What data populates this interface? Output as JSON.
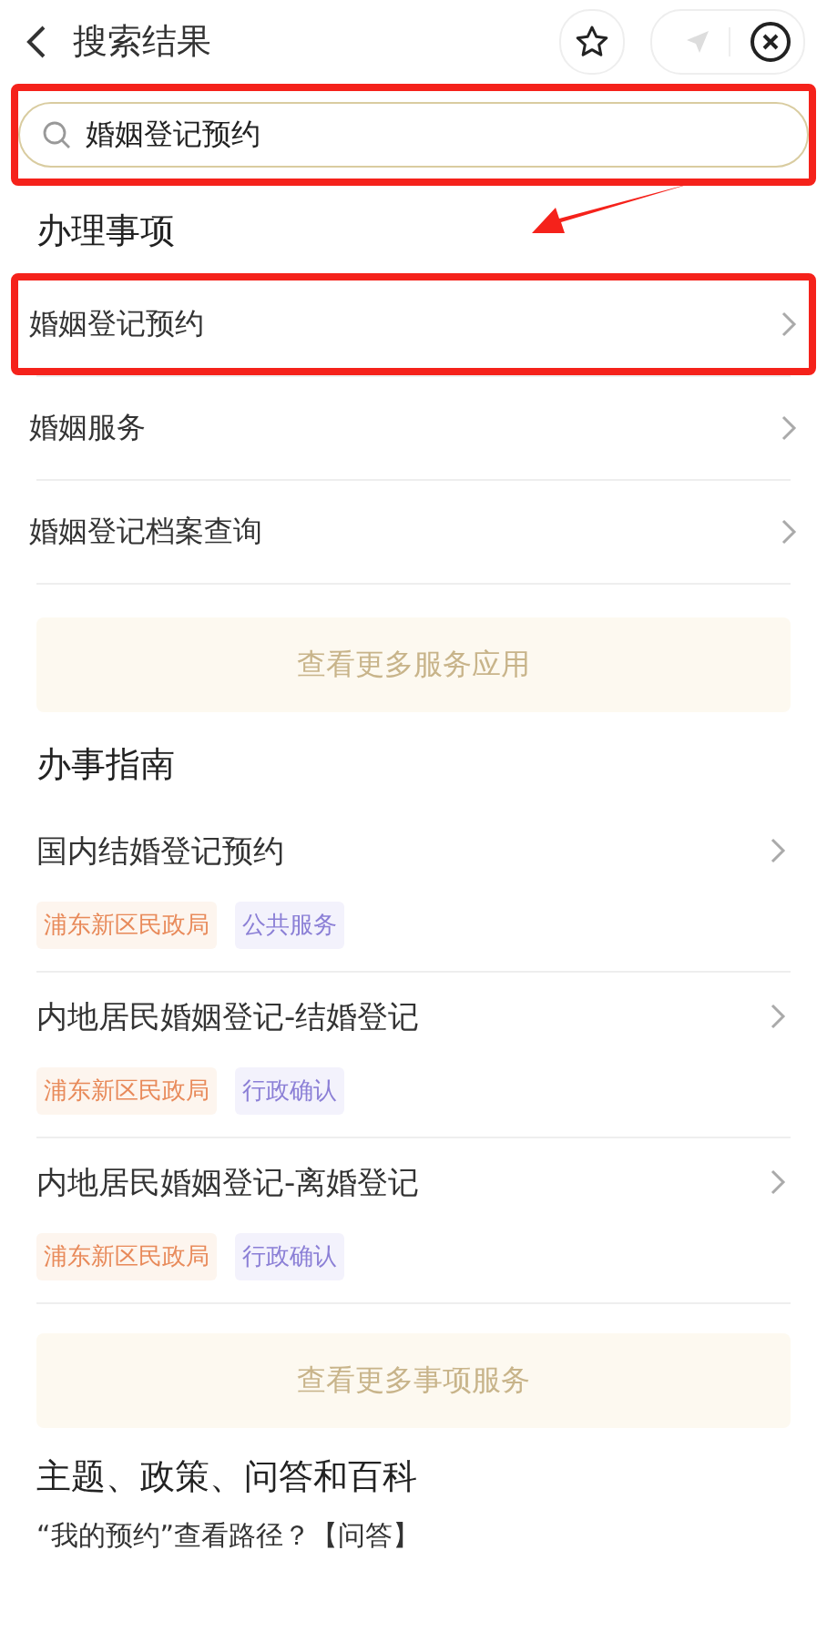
{
  "header": {
    "title": "搜索结果"
  },
  "search": {
    "value": "婚姻登记预约",
    "highlighted": true
  },
  "services": {
    "heading": "办理事项",
    "pointer_arrow": true,
    "items": [
      {
        "label": "婚姻登记预约",
        "highlighted": true
      },
      {
        "label": "婚姻服务",
        "highlighted": false
      },
      {
        "label": "婚姻登记档案查询",
        "highlighted": false
      }
    ],
    "more": "查看更多服务应用"
  },
  "guides": {
    "heading": "办事指南",
    "items": [
      {
        "title": "国内结婚登记预约",
        "tags": [
          {
            "label": "浦东新区民政局",
            "kind": "org"
          },
          {
            "label": "公共服务",
            "kind": "type"
          }
        ]
      },
      {
        "title": "内地居民婚姻登记-结婚登记",
        "tags": [
          {
            "label": "浦东新区民政局",
            "kind": "org"
          },
          {
            "label": "行政确认",
            "kind": "type"
          }
        ]
      },
      {
        "title": "内地居民婚姻登记-离婚登记",
        "tags": [
          {
            "label": "浦东新区民政局",
            "kind": "org"
          },
          {
            "label": "行政确认",
            "kind": "type"
          }
        ]
      }
    ],
    "more": "查看更多事项服务"
  },
  "topics": {
    "heading": "主题、政策、问答和百科",
    "items": [
      "“我的预约”查看路径？【问答】"
    ]
  }
}
